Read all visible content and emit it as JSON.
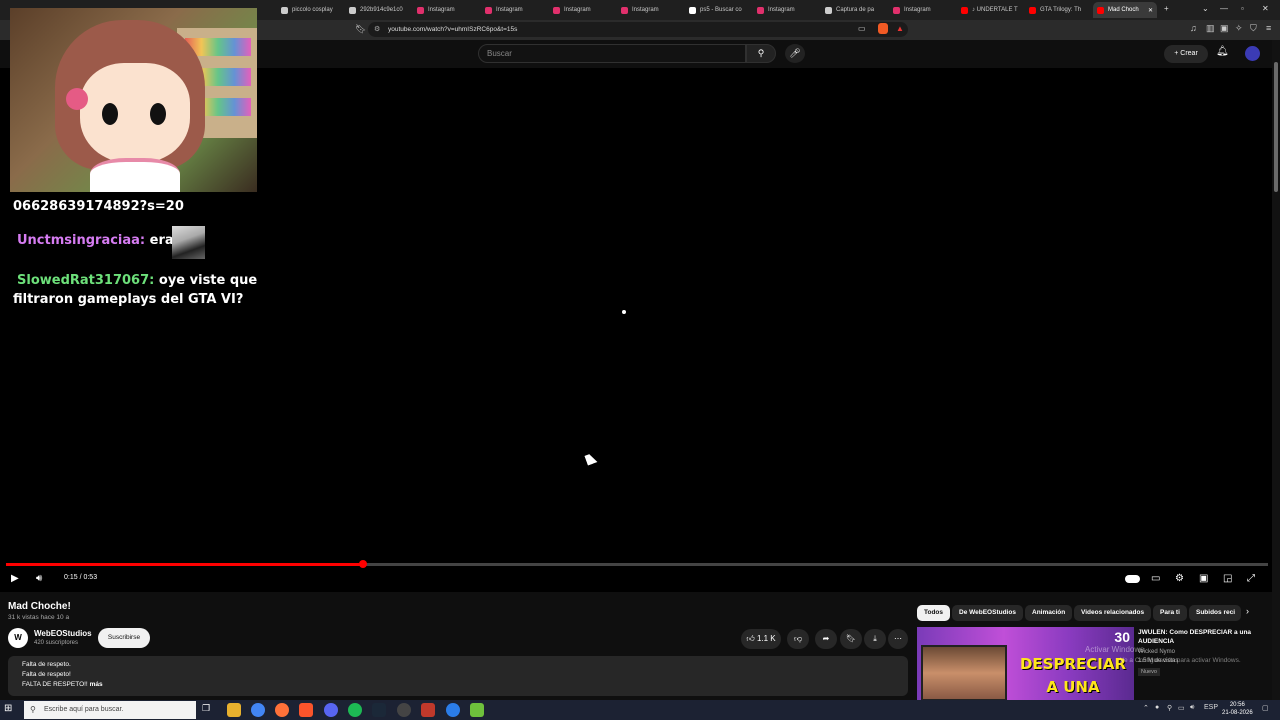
{
  "browser": {
    "tabs": [
      {
        "label": "piccolo cosplay",
        "color": "#cccccc"
      },
      {
        "label": "292b914c9e1c0",
        "color": "#cccccc"
      },
      {
        "label": "Instagram",
        "color": "#e1306c"
      },
      {
        "label": "Instagram",
        "color": "#e1306c"
      },
      {
        "label": "Instagram",
        "color": "#e1306c"
      },
      {
        "label": "Instagram",
        "color": "#e1306c"
      },
      {
        "label": "ps5 - Buscar co",
        "color": "#ffffff"
      },
      {
        "label": "Instagram",
        "color": "#e1306c"
      },
      {
        "label": "Captura de pa",
        "color": "#cccccc"
      },
      {
        "label": "Instagram",
        "color": "#e1306c"
      },
      {
        "label": "♪ UNDERTALE T",
        "color": "#ff0000"
      },
      {
        "label": "GTA Trilogy: Th",
        "color": "#ff0000"
      },
      {
        "label": "Mad Choch",
        "color": "#ff0000",
        "active": true
      }
    ],
    "url": "youtube.com/watch?v=uhmISzRC6po&t=15s"
  },
  "youtube": {
    "search_placeholder": "Buscar",
    "create_label": "Crear"
  },
  "chat": {
    "url_fragment": "06628639174892?s=20",
    "msg1": {
      "user": "Unctmsingraciaa:",
      "text": "era"
    },
    "msg2": {
      "user": "SlowedRat317067:",
      "text": "oye viste que filtraron gameplays del GTA VI?"
    }
  },
  "player": {
    "time": "0:15 / 0:53",
    "progress": 0.283
  },
  "video": {
    "title": "Mad Choche!",
    "meta": "31 k vistas  hace 10 a",
    "channel": "WebEOStudios",
    "subscribers": "420 suscriptores",
    "subscribe_label": "Suscribirse",
    "likes": "1.1 K",
    "description": [
      "Falta de respeto.",
      "Falta de respeto!",
      "FALTA DE RESPETO!!"
    ],
    "more_label": "más"
  },
  "related": {
    "chips": [
      "Todos",
      "De WebEOStudios",
      "Animación",
      "Videos relacionados",
      "Para ti",
      "Subidos reci"
    ],
    "item": {
      "title": "JWULEN: Como DESPRECIAR a una AUDIENCIA",
      "channel": "Wicked Nymo",
      "views": "1.5 M de vistas",
      "badge": "Nuevo",
      "thumb_text": "DESPRECIAR A UNA",
      "thumb_number": "30"
    },
    "watermark_title": "Activar Windows",
    "watermark_sub": "Ve a Configuración para activar Windows."
  },
  "taskbar": {
    "search_placeholder": "Escribe aquí para buscar.",
    "lang": "ESP",
    "time": "20:56",
    "date": "21-08-2026"
  }
}
